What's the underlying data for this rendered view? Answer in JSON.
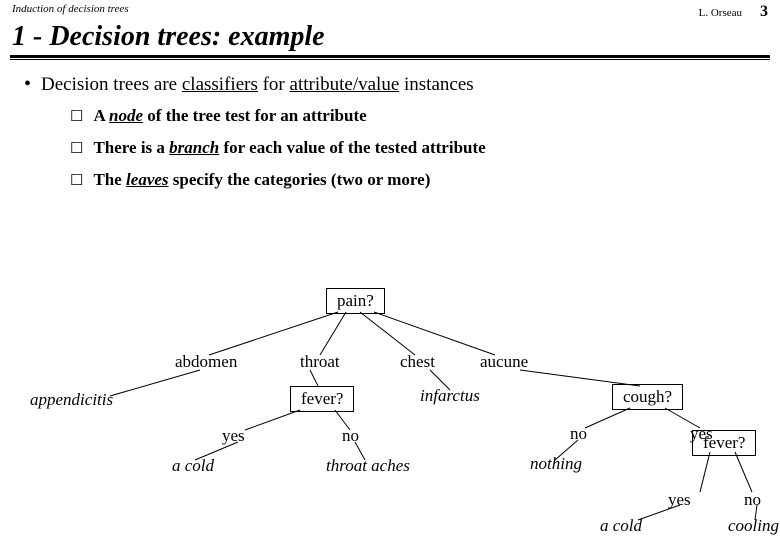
{
  "header": {
    "doc_title": "Induction of decision trees",
    "author": "L. Orseau",
    "page_number": "3"
  },
  "title": "1 - Decision trees: example",
  "main_bullet": {
    "prefix": "Decision trees are ",
    "classifiers": "classifiers",
    "mid": " for ",
    "attrval": "attribute/value",
    "suffix": "  instances"
  },
  "sub": {
    "a_prefix": "A ",
    "a_node": "node",
    "a_suffix": " of the tree test for an attribute",
    "b_prefix": "There is a ",
    "b_branch": "branch",
    "b_suffix": " for each value of the tested attribute",
    "c_prefix": "The ",
    "c_leaves": "leaves",
    "c_suffix": " specify the categories (two or more)"
  },
  "tree": {
    "root": "pain?",
    "b_abdomen": "abdomen",
    "b_throat": "throat",
    "b_chest": "chest",
    "b_aucune": "aucune",
    "leaf_appendicitis": "appendicitis",
    "fever": "fever?",
    "leaf_infarctus": "infarctus",
    "cough": "cough?",
    "b_yes": "yes",
    "b_no": "no",
    "leaf_a_cold": "a cold",
    "leaf_throat_aches": "throat aches",
    "leaf_nothing": "nothing",
    "fever2": "fever?",
    "b_yes2": "yes",
    "b_no2": "no",
    "leaf_a_cold2": "a cold",
    "leaf_cooling": "cooling"
  }
}
